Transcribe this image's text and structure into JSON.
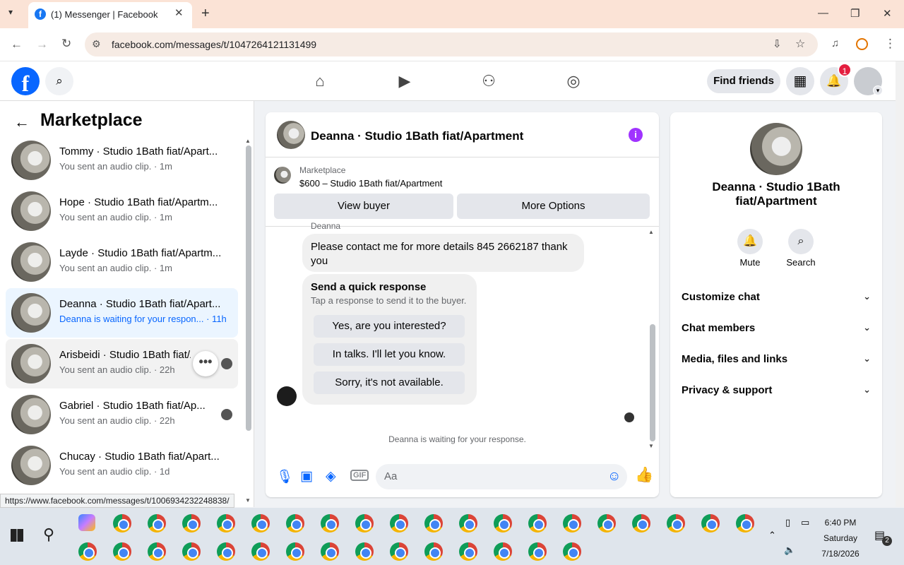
{
  "browser": {
    "tab_title": "(1) Messenger | Facebook",
    "tab_favicon": "f",
    "url": "facebook.com/messages/t/1047264121131499",
    "status_link": "https://www.facebook.com/messages/t/1006934232248838/"
  },
  "header": {
    "logo": "f",
    "find_friends": "Find friends",
    "notif_count": "1"
  },
  "left": {
    "title": "Marketplace",
    "conversations": [
      {
        "name": "Tommy · Studio 1Bath fiat/Apart...",
        "sub": "You sent an audio clip. · 1m"
      },
      {
        "name": "Hope · Studio 1Bath fiat/Apartm...",
        "sub": "You sent an audio clip. · 1m"
      },
      {
        "name": "Layde · Studio 1Bath fiat/Apartm...",
        "sub": "You sent an audio clip. · 1m"
      },
      {
        "name": "Deanna · Studio 1Bath fiat/Apart...",
        "sub": "Deanna is waiting for your respon... · 11h"
      },
      {
        "name": "Arisbeidi · Studio 1Bath fiat/A...",
        "sub": "You sent an audio clip. · 22h"
      },
      {
        "name": "Gabriel · Studio 1Bath fiat/Ap...",
        "sub": "You sent an audio clip. · 22h"
      },
      {
        "name": "Chucay · Studio 1Bath fiat/Apart...",
        "sub": "You sent an audio clip. · 1d"
      }
    ]
  },
  "chat": {
    "title": "Deanna · Studio 1Bath fiat/Apartment",
    "info_icon": "i",
    "marketplace_label": "Marketplace",
    "listing": "$600 – Studio 1Bath fiat/Apartment",
    "view_buyer": "View buyer",
    "more_options": "More Options",
    "sender_label": "Deanna",
    "message": "Please contact me for more details 845 2662187 thank you",
    "quick_title": "Send a quick response",
    "quick_sub": "Tap a response to send it to the buyer.",
    "quick_replies": [
      "Yes, are you interested?",
      "In talks. I'll let you know.",
      "Sorry, it's not available."
    ],
    "waiting": "Deanna is waiting for your response.",
    "input_placeholder": "Aa"
  },
  "right": {
    "name": "Deanna · Studio 1Bath fiat/Apartment",
    "mute": "Mute",
    "search": "Search",
    "rows": [
      "Customize chat",
      "Chat members",
      "Media, files and links",
      "Privacy & support"
    ]
  },
  "taskbar": {
    "time": "6:40 PM",
    "day": "Saturday",
    "date": "7/18/2026",
    "notif": "2"
  }
}
